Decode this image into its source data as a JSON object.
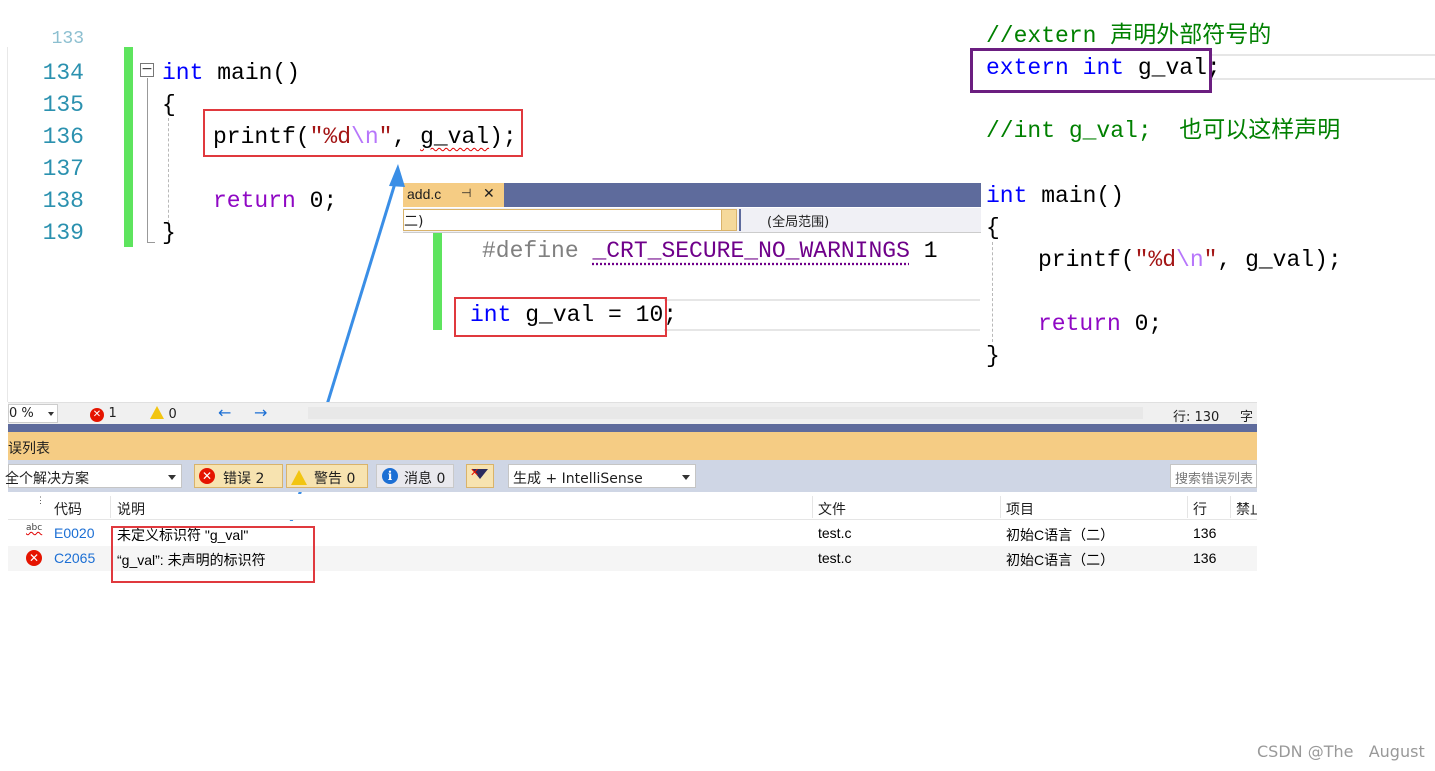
{
  "left_editor": {
    "partial_line_number": "133",
    "line_numbers": [
      "134",
      "135",
      "136",
      "137",
      "138",
      "139"
    ],
    "collapse_symbol": "−",
    "line134": {
      "kw": "int",
      "rest": " main()"
    },
    "line135": "{",
    "line136": {
      "fn": "printf(",
      "str1": "\"%d",
      "esc": "\\n",
      "str2": "\"",
      "comma": ", ",
      "ident": "g_val",
      "end": ");"
    },
    "line138": {
      "kw": "return",
      "rest": " 0;"
    },
    "line139": "}"
  },
  "right_code": {
    "comment1": "//extern 声明外部符号的",
    "extern_kw": "extern",
    "int_kw": "int",
    "decl_rest": " g_val;",
    "comment2": "//int g_val;  也可以这样声明",
    "main_kw": "int",
    "main_rest": " main()",
    "open_brace": "{",
    "printf_fn": "printf(",
    "printf_str1": "\"%d",
    "printf_esc": "\\n",
    "printf_str2": "\"",
    "printf_rest": ", g_val);",
    "return_kw": "return",
    "return_rest": " 0;",
    "close_brace": "}"
  },
  "add_window": {
    "tab_label": "add.c",
    "pin_icon": "⊣",
    "close_icon": "✕",
    "project_dropdown_value": "二)",
    "scope_dropdown_value": "(全局范围)",
    "define_kw": "#define",
    "define_macro": "_CRT_SECURE_NO_WARNINGS",
    "define_value": " 1",
    "decl_kw": "int",
    "decl_rest": " g_val = 10;"
  },
  "status_bar": {
    "zoom": "0 %",
    "error_count": "1",
    "warning_count": "0",
    "line_label": "行: 130",
    "char_label": "字"
  },
  "error_list": {
    "title": "误列表",
    "scope_dropdown": "全个解决方案",
    "errors_button": "错误 2",
    "warnings_button": "警告 0",
    "messages_button": "消息 0",
    "build_dropdown": "生成 + IntelliSense",
    "search_placeholder": "搜索错误列表",
    "columns": [
      "代码",
      "说明",
      "文件",
      "项目",
      "行",
      "禁止"
    ],
    "rows": [
      {
        "icon": "abc",
        "code": "E0020",
        "desc": "未定义标识符 \"g_val\"",
        "file": "test.c",
        "project": "初始C语言（二）",
        "line": "136"
      },
      {
        "icon": "error",
        "code": "C2065",
        "desc": "“g_val”: 未声明的标识符",
        "file": "test.c",
        "project": "初始C语言（二）",
        "line": "136"
      }
    ]
  },
  "watermark": "CSDN @The   August",
  "colors": {
    "keyword": "#0000ff",
    "return_keyword": "#8f08c4",
    "string": "#a31515",
    "comment": "#008000",
    "line_number": "#2b91af",
    "change_bar": "#5ee45e",
    "annotation_red": "#e0393e",
    "annotation_purple": "#6b1e80",
    "arrow_blue": "#3a8ee6",
    "tab_gold": "#f5cc84",
    "tabbar_blue": "#5e6b9c"
  }
}
